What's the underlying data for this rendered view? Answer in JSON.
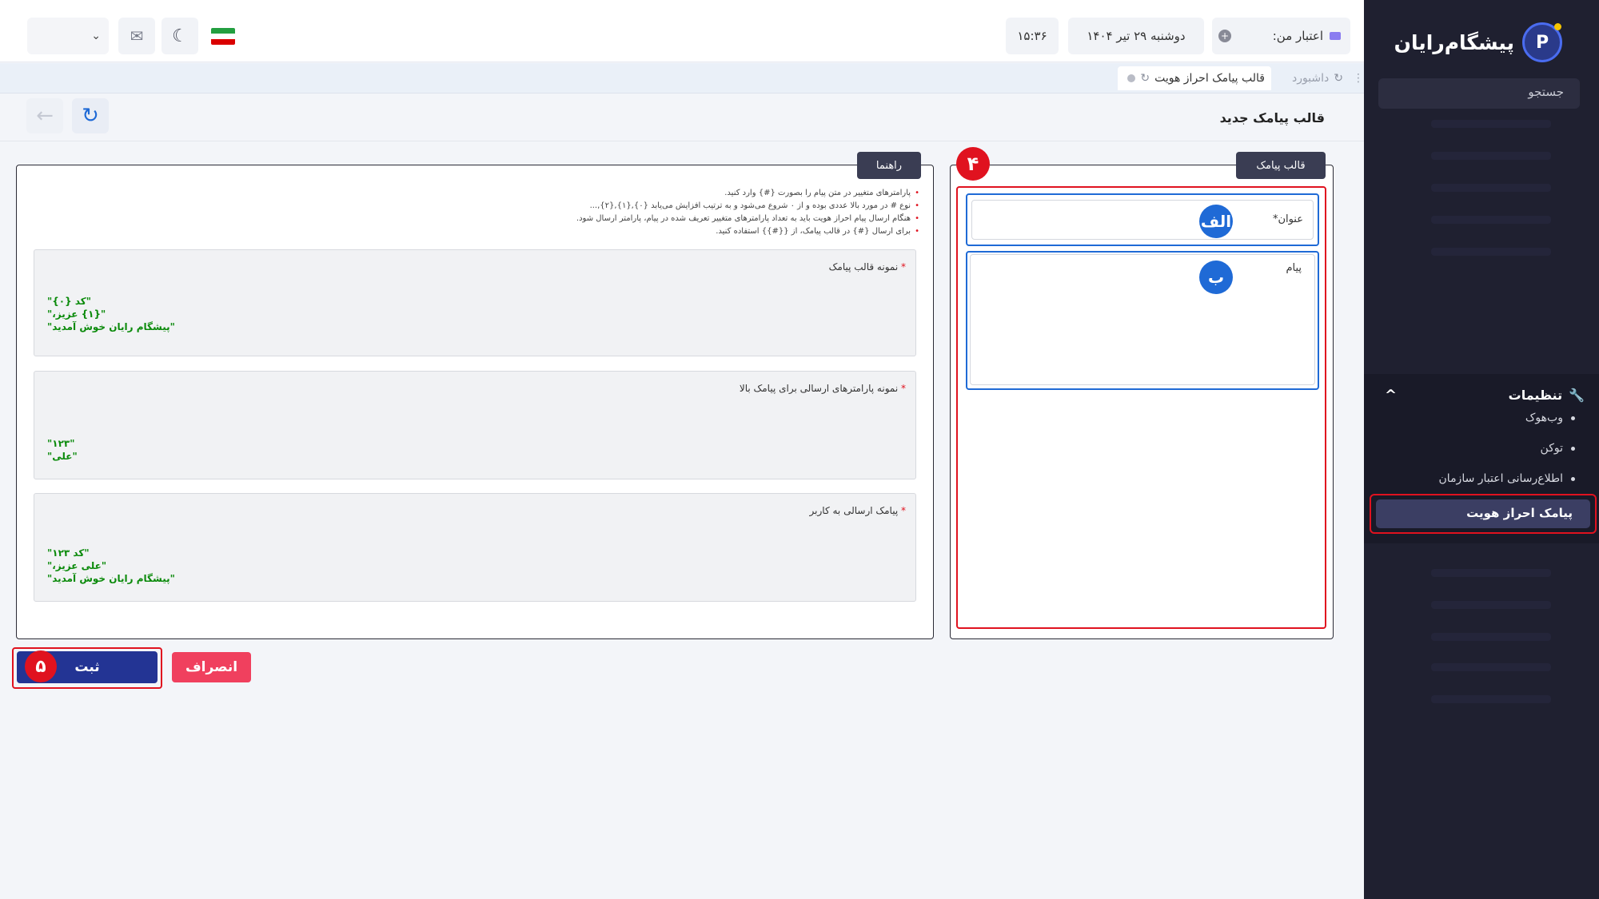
{
  "sidebar": {
    "brand": "پیشگام‌رایان",
    "search_placeholder": "جستجو",
    "settings": {
      "label": "تنظیمات",
      "items": [
        "وب‌هوک",
        "توکن",
        "اطلاع‌رسانی اعتبار سازمان"
      ],
      "active_item": "پیامک احراز هویت"
    }
  },
  "topbar": {
    "credit_label": "اعتبار من:",
    "date": "دوشنبه ۲۹ تیر ۱۴۰۴",
    "time": "۱۵:۳۶"
  },
  "tabs": {
    "dashboard": "داشبورد",
    "current": "قالب پیامک احراز هویت"
  },
  "page": {
    "title": "قالب پیامک جدید"
  },
  "form": {
    "panel_label": "قالب پیامک",
    "title_label": "عنوان*",
    "message_label": "پیام",
    "badge_alef": "الف",
    "badge_be": "ب",
    "badge_section": "۴"
  },
  "guide": {
    "panel_label": "راهنما",
    "notes": [
      "پارامترهای متغییر در متن پیام را بصورت {#} وارد کنید.",
      "نوع # در مورد بالا عددی بوده و از ۰ شروع می‌شود و به ترتیب افزایش می‌یابد {۰},{۱},{۲},...",
      "هنگام ارسال پیام احراز هویت باید به تعداد پارامترهای متغییر تعریف شده در پیام، پارامتر ارسال شود.",
      "برای ارسال {#} در قالب پیامک، از {{#}} استفاده کنید."
    ],
    "sample_template_label": "نمونه قالب پیامک",
    "sample_template": "\"کد {۰}\"\n\"{۱} عزیز،\"\n\"پیشگام رایان خوش آمدید\"",
    "sample_params_label": "نمونه پارامترهای ارسالی برای پیامک بالا",
    "sample_params": "\"۱۲۳\"\n\"علی\"",
    "sent_message_label": "پیامک ارسالی به کاربر",
    "sent_message": "\"کد ۱۲۳\"\n\"علی عزیز،\"\n\"پیشگام رایان خوش آمدید\""
  },
  "actions": {
    "submit": "ثبت",
    "cancel": "انصراف",
    "badge_submit": "۵"
  }
}
